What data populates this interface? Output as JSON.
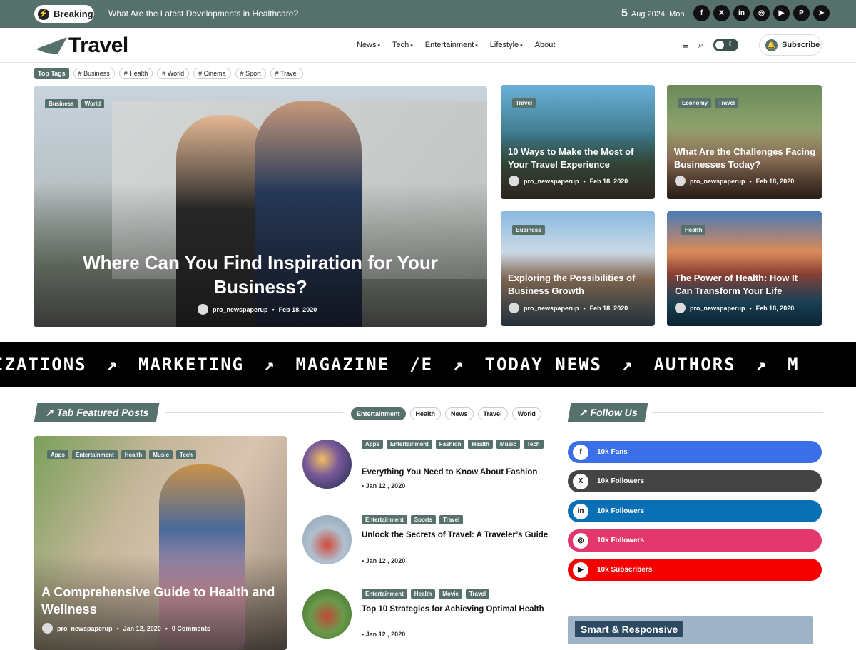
{
  "topbar": {
    "breaking_label": "Breaking",
    "headline": "What Are the Latest Developments in Healthcare?",
    "date_day": "5",
    "date_rest": "Aug 2024, Mon",
    "socials": [
      "f",
      "X",
      "in",
      "◎",
      "▶",
      "P",
      "➤"
    ]
  },
  "header": {
    "logo": "Travel",
    "menu": [
      {
        "label": "News",
        "caret": "▾"
      },
      {
        "label": "Tech",
        "caret": "▾"
      },
      {
        "label": "Entertainment",
        "caret": "▾"
      },
      {
        "label": "Lifestyle",
        "caret": "▾"
      },
      {
        "label": "About",
        "caret": ""
      }
    ],
    "subscribe_label": "Subscribe"
  },
  "top_tags": {
    "lead": "Top Tags",
    "tags": [
      "# Business",
      "# Health",
      "# World",
      "# Cinema",
      "# Sport",
      "# Travel"
    ]
  },
  "hero": {
    "badges": [
      "Business",
      "World"
    ],
    "title": "Where Can You Find Inspiration for Your Business?",
    "author": "pro_newspaperup",
    "date": "Feb 18, 2020"
  },
  "grid_posts": [
    {
      "badges": [
        "Travel"
      ],
      "title": "10 Ways to Make the Most of Your Travel Experience",
      "author": "pro_newspaperup",
      "date": "Feb 18, 2020"
    },
    {
      "badges": [
        "Economy",
        "Travel"
      ],
      "title": "What Are the Challenges Facing Businesses Today?",
      "author": "pro_newspaperup",
      "date": "Feb 18, 2020"
    },
    {
      "badges": [
        "Business"
      ],
      "title": "Exploring the Possibilities of Business Growth",
      "author": "pro_newspaperup",
      "date": "Feb 18, 2020"
    },
    {
      "badges": [
        "Health"
      ],
      "title": "The Power of Health: How It Can Transform Your Life",
      "author": "pro_newspaperup",
      "date": "Feb 18, 2020"
    }
  ],
  "marquee": [
    "IZATIONS",
    "↗",
    "MARKETING",
    "↗",
    "MAGAZINE",
    "/E",
    "↗",
    "TODAY NEWS",
    "↗",
    "AUTHORS",
    "↗",
    "M"
  ],
  "tab_featured": {
    "heading": "↗ Tab Featured Posts",
    "tabs": [
      "Entertainment",
      "Health",
      "News",
      "Travel",
      "World"
    ],
    "big": {
      "badges": [
        "Apps",
        "Entertainment",
        "Health",
        "Music",
        "Tech"
      ],
      "title": "A Comprehensive Guide to Health and Wellness",
      "author": "pro_newspaperup",
      "date": "Jan 12, 2020",
      "comments": "0 Comments"
    },
    "list": [
      {
        "badges": [
          "Apps",
          "Entertainment",
          "Fashion",
          "Health",
          "Music",
          "Tech"
        ],
        "title": "Everything You Need to Know About Fashion",
        "date": "Jan 12 , 2020"
      },
      {
        "badges": [
          "Entertainment",
          "Sports",
          "Travel"
        ],
        "title": "Unlock the Secrets of Travel: A Traveler’s Guide",
        "date": "Jan 12 , 2020"
      },
      {
        "badges": [
          "Entertainment",
          "Health",
          "Movie",
          "Travel"
        ],
        "title": "Top 10 Strategies for Achieving Optimal Health",
        "date": "Jan 12 , 2020"
      }
    ]
  },
  "follow": {
    "heading": "↗ Follow Us",
    "items": [
      {
        "icon": "f",
        "label": "10k Fans",
        "color": "#3b6fe8"
      },
      {
        "icon": "X",
        "label": "10k Followers",
        "color": "#444444"
      },
      {
        "icon": "in",
        "label": "10k Followers",
        "color": "#0a70b5"
      },
      {
        "icon": "◎",
        "label": "10k Followers",
        "color": "#e2386e"
      },
      {
        "icon": "▶",
        "label": "10k Subscribers",
        "color": "#f50000"
      }
    ]
  },
  "promo": {
    "label": "Smart & Responsive"
  }
}
